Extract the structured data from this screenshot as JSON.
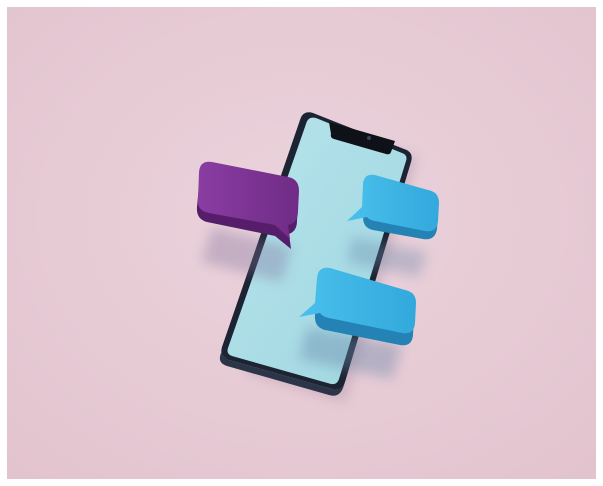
{
  "scene": {
    "background_color": "#e6cad4",
    "phone": {
      "body_color": "#1c2433",
      "screen_color": "#a9dde6",
      "notch_color": "#0e1118"
    },
    "bubbles": [
      {
        "name": "purple-chat-bubble",
        "color": "#6e2a86",
        "side": "left"
      },
      {
        "name": "blue-chat-bubble-top",
        "color": "#36ade0",
        "side": "right"
      },
      {
        "name": "blue-chat-bubble-bottom",
        "color": "#36ade0",
        "side": "right"
      }
    ]
  }
}
